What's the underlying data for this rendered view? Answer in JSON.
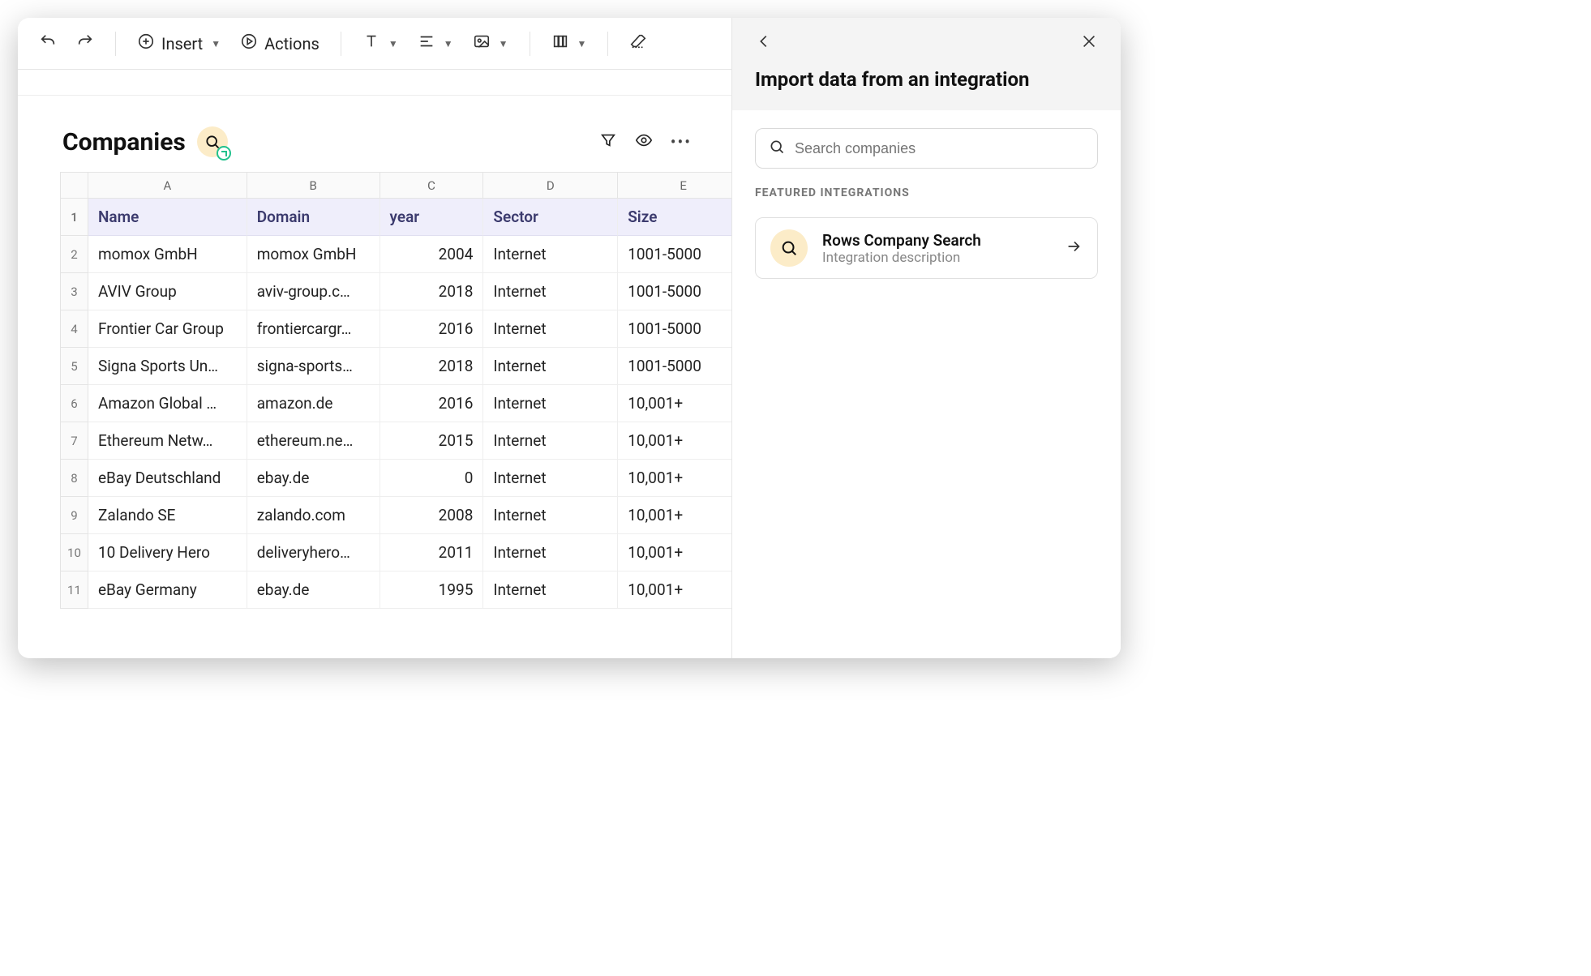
{
  "toolbar": {
    "insert_label": "Insert",
    "actions_label": "Actions"
  },
  "sheet": {
    "title": "Companies",
    "column_letters": [
      "A",
      "B",
      "C",
      "D",
      "E"
    ],
    "headers": [
      "Name",
      "Domain",
      "year",
      "Sector",
      "Size"
    ],
    "rows": [
      {
        "n": "1"
      },
      {
        "n": "2",
        "name": "momox GmbH",
        "domain": "momox GmbH",
        "year": "2004",
        "sector": "Internet",
        "size": "1001-5000"
      },
      {
        "n": "3",
        "name": "AVIV Group",
        "domain": "aviv-group.c…",
        "year": "2018",
        "sector": "Internet",
        "size": "1001-5000"
      },
      {
        "n": "4",
        "name": "Frontier Car Group",
        "domain": "frontiercargr…",
        "year": "2016",
        "sector": "Internet",
        "size": "1001-5000"
      },
      {
        "n": "5",
        "name": "Signa Sports Un…",
        "domain": "signa-sports…",
        "year": "2018",
        "sector": "Internet",
        "size": "1001-5000"
      },
      {
        "n": "6",
        "name": "Amazon Global …",
        "domain": "amazon.de",
        "year": "2016",
        "sector": "Internet",
        "size": "10,001+"
      },
      {
        "n": "7",
        "name": "Ethereum Netw…",
        "domain": "ethereum.ne…",
        "year": "2015",
        "sector": "Internet",
        "size": "10,001+"
      },
      {
        "n": "8",
        "name": "eBay Deutschland",
        "domain": "ebay.de",
        "year": "0",
        "sector": "Internet",
        "size": "10,001+"
      },
      {
        "n": "9",
        "name": "Zalando SE",
        "domain": "zalando.com",
        "year": "2008",
        "sector": "Internet",
        "size": "10,001+"
      },
      {
        "n": "10",
        "name": "10 Delivery Hero",
        "domain": "deliveryhero…",
        "year": "2011",
        "sector": "Internet",
        "size": "10,001+"
      },
      {
        "n": "11",
        "name": "eBay Germany",
        "domain": "ebay.de",
        "year": "1995",
        "sector": "Internet",
        "size": "10,001+"
      }
    ]
  },
  "sidebar": {
    "title": "Import data from an integration",
    "search_placeholder": "Search companies",
    "featured_label": "FEATURED INTEGRATIONS",
    "integration": {
      "title": "Rows Company Search",
      "desc": "Integration description"
    }
  }
}
